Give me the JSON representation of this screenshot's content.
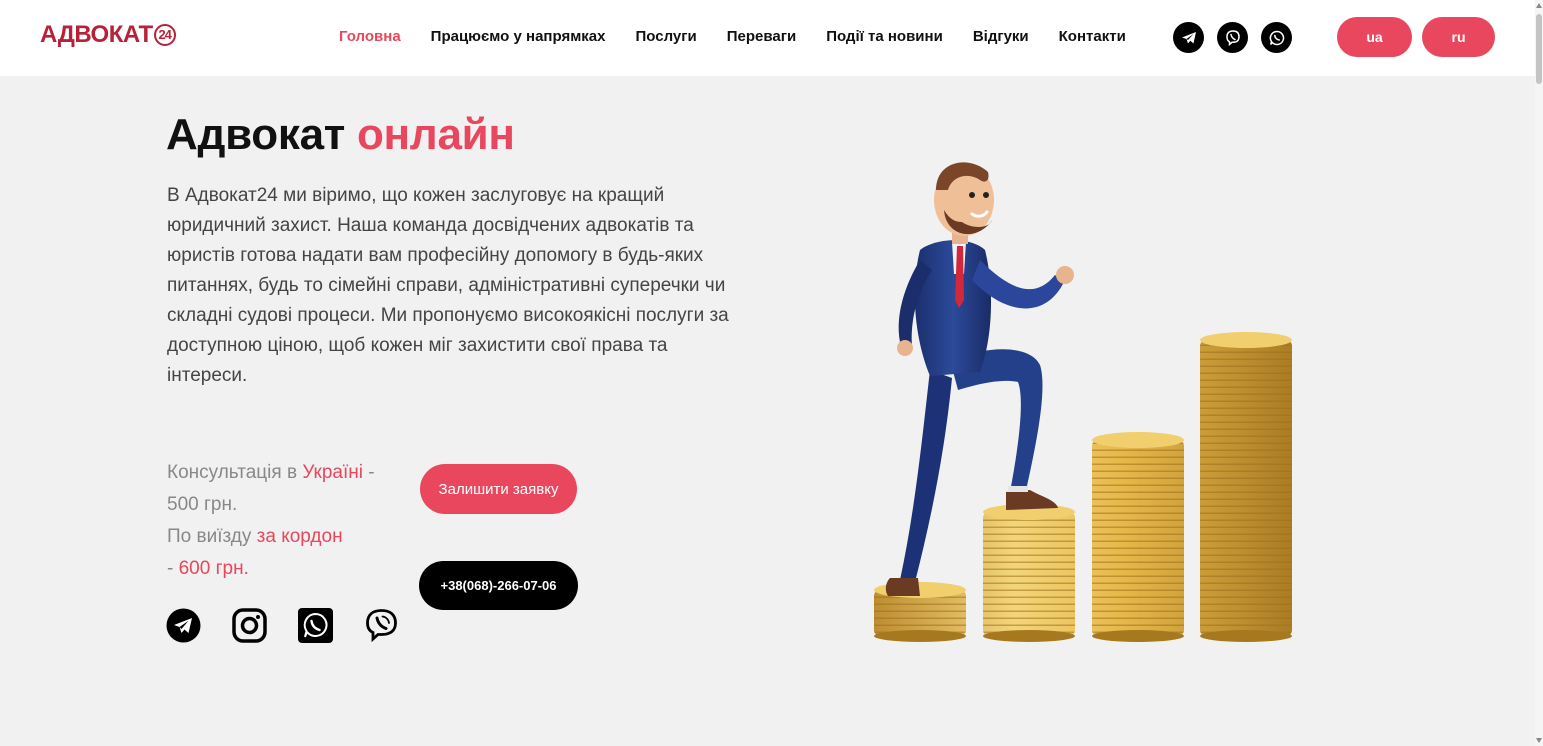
{
  "header": {
    "logo": "АДВОКАТ",
    "logo_badge": "24",
    "nav": [
      "Головна",
      "Працюємо у напрямках",
      "Послуги",
      "Переваги",
      "Події та новини",
      "Відгуки",
      "Контакти"
    ],
    "social_icons": [
      "telegram-icon",
      "viber-icon",
      "whatsapp-icon"
    ],
    "lang_ua": "ua",
    "lang_ru": "ru"
  },
  "hero": {
    "title_main": "Адвокат",
    "title_accent": "онлайн",
    "description": "В Адвокат24 ми віримо, що кожен заслуговує на кращий юридичний захист. Наша команда досвідчених адвокатів та юристів готова надати вам професійну допомогу в будь-яких питаннях, будь то сімейні справи, адміністративні суперечки чи складні судові процеси. Ми пропонуємо високоякісні послуги за доступною ціною, щоб кожен міг захистити свої права та інтереси.",
    "consult_line1_prefix": "Консультація в ",
    "consult_line1_accent": "Україні",
    "consult_line1_suffix": " -",
    "consult_line2": "500 грн.",
    "consult_line3_prefix": "По виїзду ",
    "consult_line3_accent": "за кордон",
    "consult_line4_prefix": "- ",
    "consult_line4_accent": "600 грн.",
    "request_button": "Залишити заявку",
    "phone_button": "+38(068)-266-07-06",
    "social_icons": [
      "telegram-icon",
      "instagram-icon",
      "whatsapp-icon",
      "viber-icon"
    ]
  },
  "colors": {
    "accent": "#e8475d",
    "logo": "#b8213a",
    "background": "#f0f1f0"
  }
}
